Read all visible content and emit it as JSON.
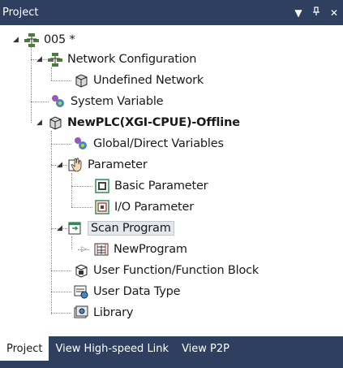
{
  "panel": {
    "title": "Project",
    "dropdown_glyph": "▼",
    "pin_glyph": "ᛘ",
    "close_glyph": "✕"
  },
  "tree": {
    "root": {
      "label": "005 *",
      "icon": "project-icon"
    },
    "network_configuration": {
      "label": "Network Configuration",
      "icon": "network-icon"
    },
    "undefined_network": {
      "label": "Undefined Network",
      "icon": "cube-icon"
    },
    "system_variable": {
      "label": "System Variable",
      "icon": "variables-icon"
    },
    "plc": {
      "label": "NewPLC(XGI-CPUE)-Offline",
      "icon": "plc-icon"
    },
    "global_variables": {
      "label": "Global/Direct Variables",
      "icon": "variables-icon"
    },
    "parameter": {
      "label": "Parameter",
      "icon": "parameter-hand-icon"
    },
    "basic_parameter": {
      "label": "Basic Parameter",
      "icon": "parameter-icon"
    },
    "io_parameter": {
      "label": "I/O Parameter",
      "icon": "io-parameter-icon"
    },
    "scan_program": {
      "label": "Scan Program",
      "icon": "scan-program-icon"
    },
    "new_program": {
      "label": "NewProgram",
      "icon": "ladder-program-icon"
    },
    "user_function": {
      "label": "User Function/Function Block",
      "icon": "function-block-icon"
    },
    "user_data_type": {
      "label": "User Data Type",
      "icon": "data-type-icon"
    },
    "library": {
      "label": "Library",
      "icon": "library-icon"
    }
  },
  "tabs": [
    {
      "label": "Project",
      "active": true
    },
    {
      "label": "View High-speed Link",
      "active": false
    },
    {
      "label": "View P2P",
      "active": false
    }
  ],
  "colors": {
    "titlebar": "#2e3f5f",
    "selection": "#e4e8ee"
  }
}
